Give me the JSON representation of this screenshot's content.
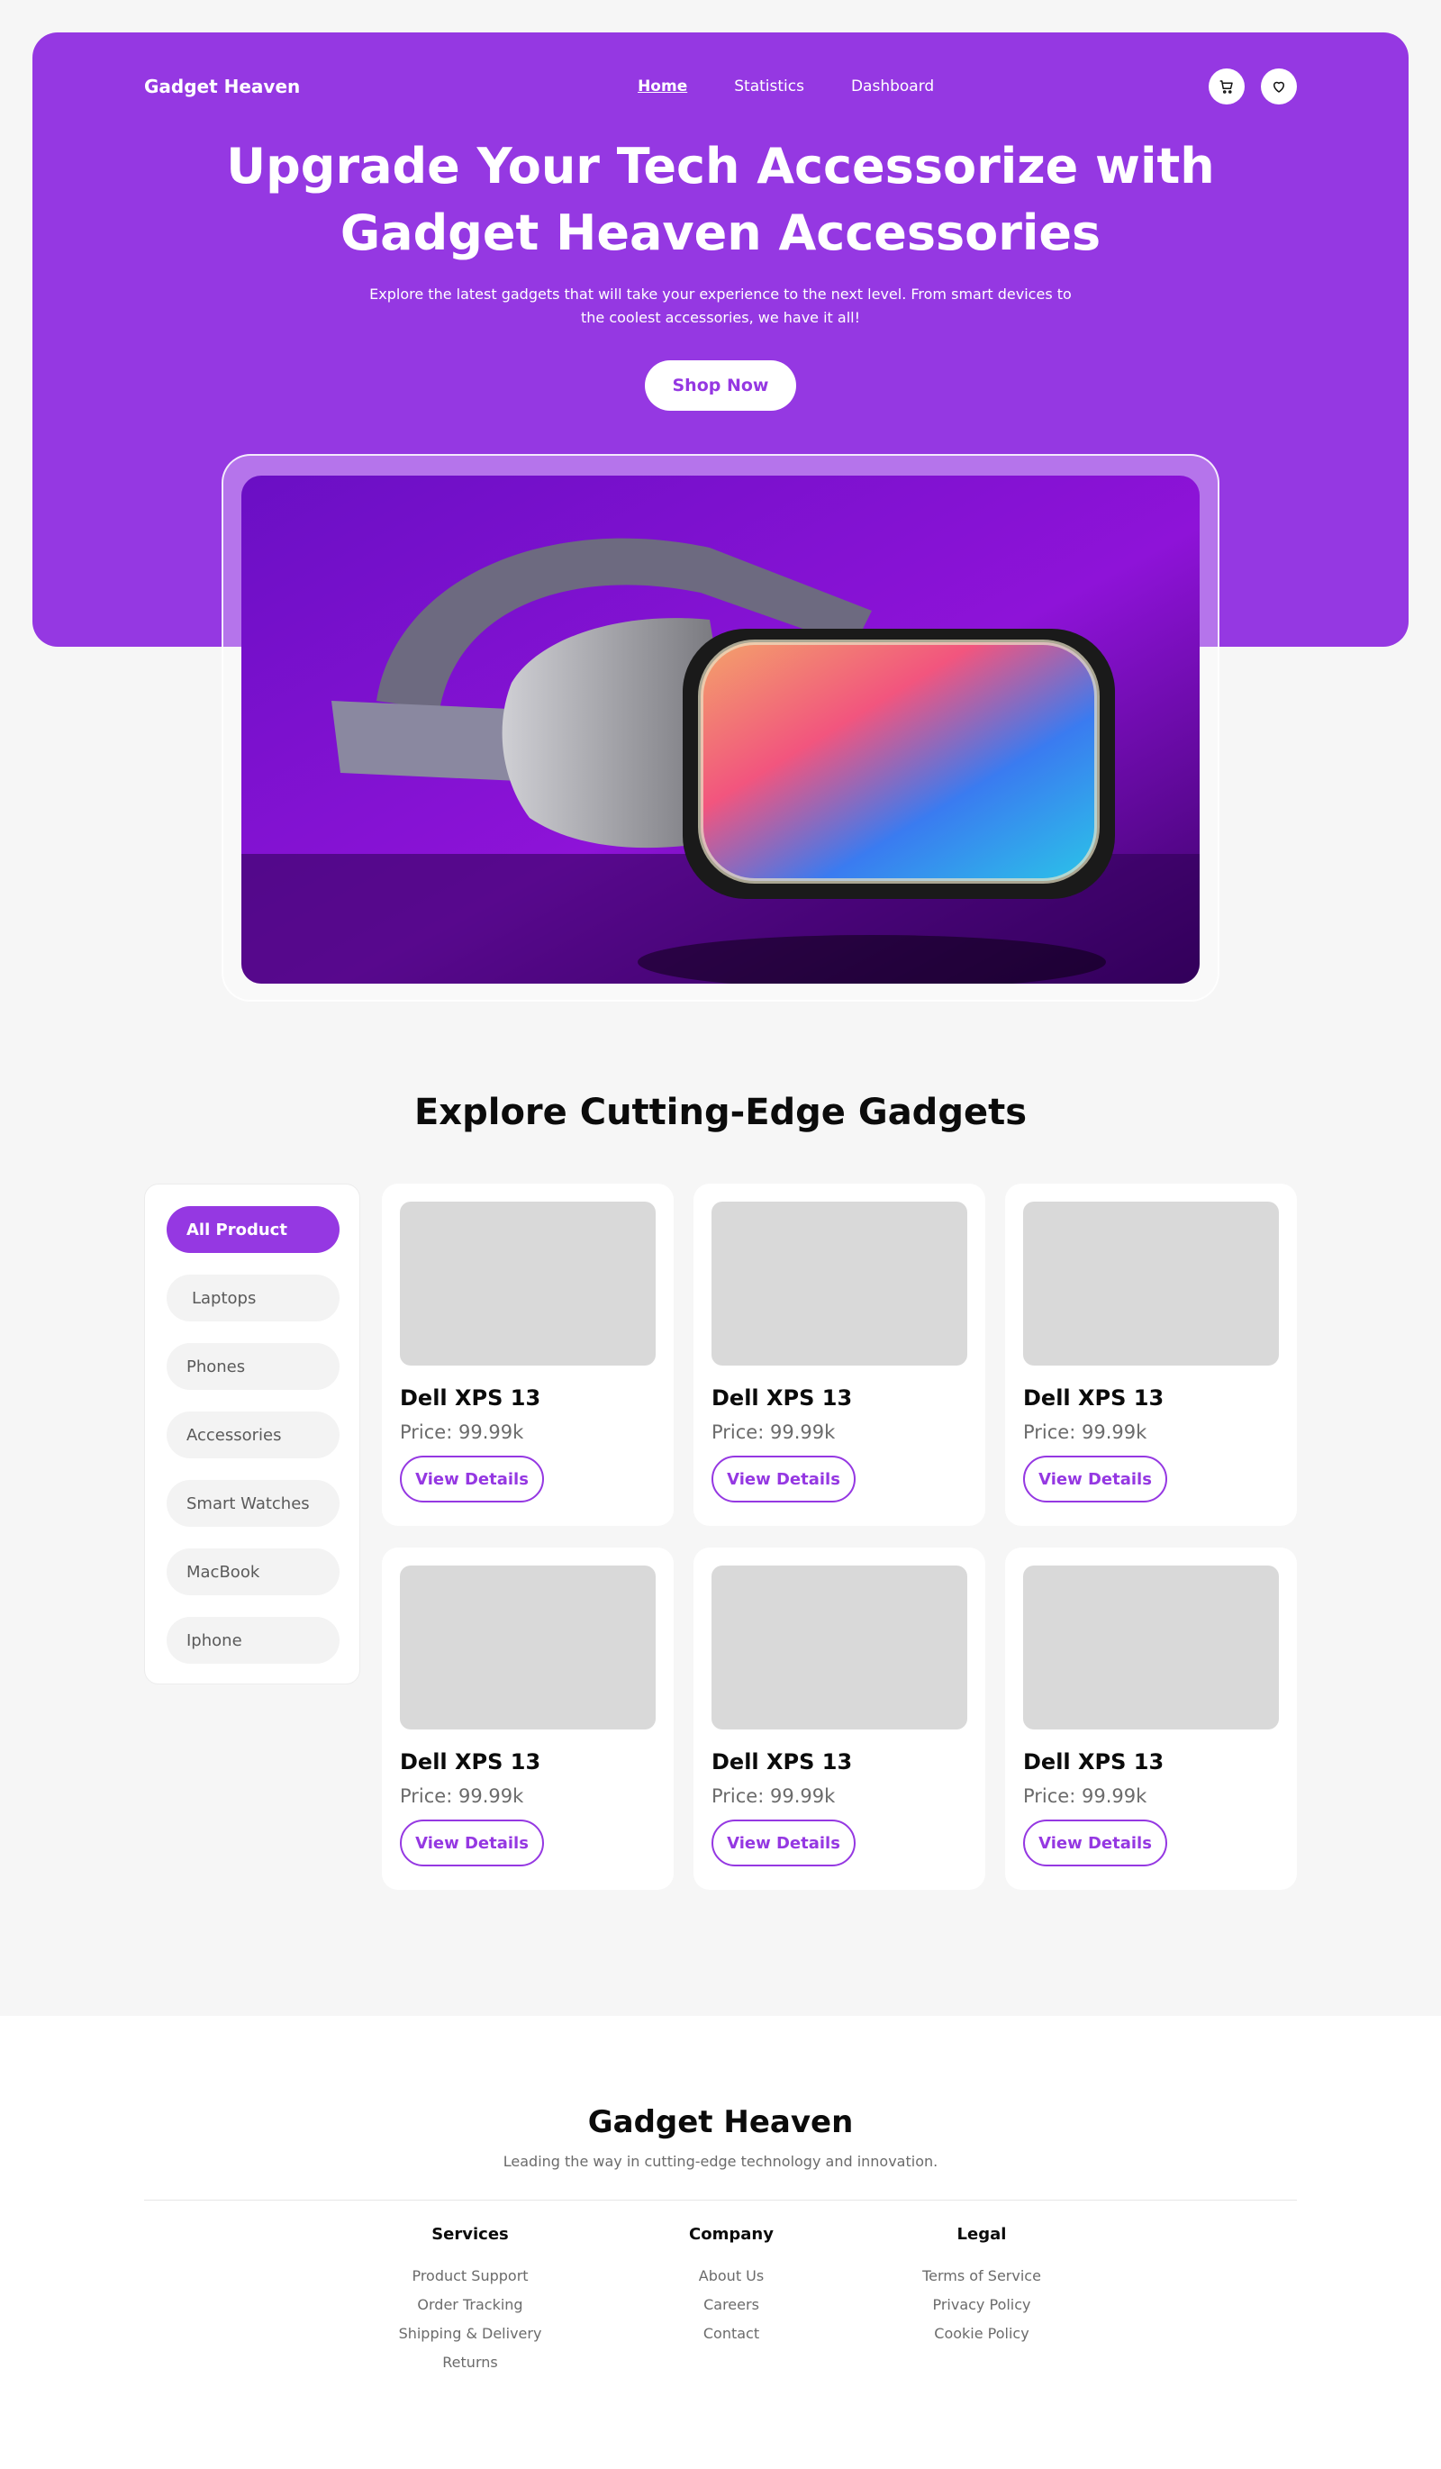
{
  "header": {
    "brand": "Gadget Heaven",
    "nav": [
      "Home",
      "Statistics",
      "Dashboard"
    ],
    "active_nav": "Home",
    "icons": [
      "cart-icon",
      "heart-icon"
    ]
  },
  "hero": {
    "title_line1": "Upgrade Your Tech Accessorize with",
    "title_line2": "Gadget Heaven Accessories",
    "subtitle_line1": "Explore the latest gadgets that will take your experience to the next level. From smart devices to",
    "subtitle_line2": "the coolest accessories, we have it all!",
    "cta": "Shop Now"
  },
  "explore": {
    "title": "Explore Cutting-Edge Gadgets",
    "categories": [
      "All Product",
      "Laptops",
      "Phones",
      "Accessories",
      "Smart Watches",
      "MacBook",
      "Iphone"
    ],
    "active_category": "All Product",
    "products": [
      {
        "name": "Dell XPS 13",
        "price": "Price: 99.99k",
        "button": "View Details"
      },
      {
        "name": "Dell XPS 13",
        "price": "Price: 99.99k",
        "button": "View Details"
      },
      {
        "name": "Dell XPS 13",
        "price": "Price: 99.99k",
        "button": "View Details"
      },
      {
        "name": "Dell XPS 13",
        "price": "Price: 99.99k",
        "button": "View Details"
      },
      {
        "name": "Dell XPS 13",
        "price": "Price: 99.99k",
        "button": "View Details"
      },
      {
        "name": "Dell XPS 13",
        "price": "Price: 99.99k",
        "button": "View Details"
      }
    ]
  },
  "footer": {
    "brand": "Gadget Heaven",
    "tagline": "Leading the way in cutting-edge technology and innovation.",
    "columns": [
      {
        "title": "Services",
        "links": [
          "Product Support",
          "Order Tracking",
          "Shipping & Delivery",
          "Returns"
        ]
      },
      {
        "title": "Company",
        "links": [
          "About Us",
          "Careers",
          "Contact"
        ]
      },
      {
        "title": "Legal",
        "links": [
          "Terms of Service",
          "Privacy Policy",
          "Cookie Policy"
        ]
      }
    ]
  },
  "colors": {
    "accent": "#9538e2",
    "background": "#f6f6f6"
  }
}
